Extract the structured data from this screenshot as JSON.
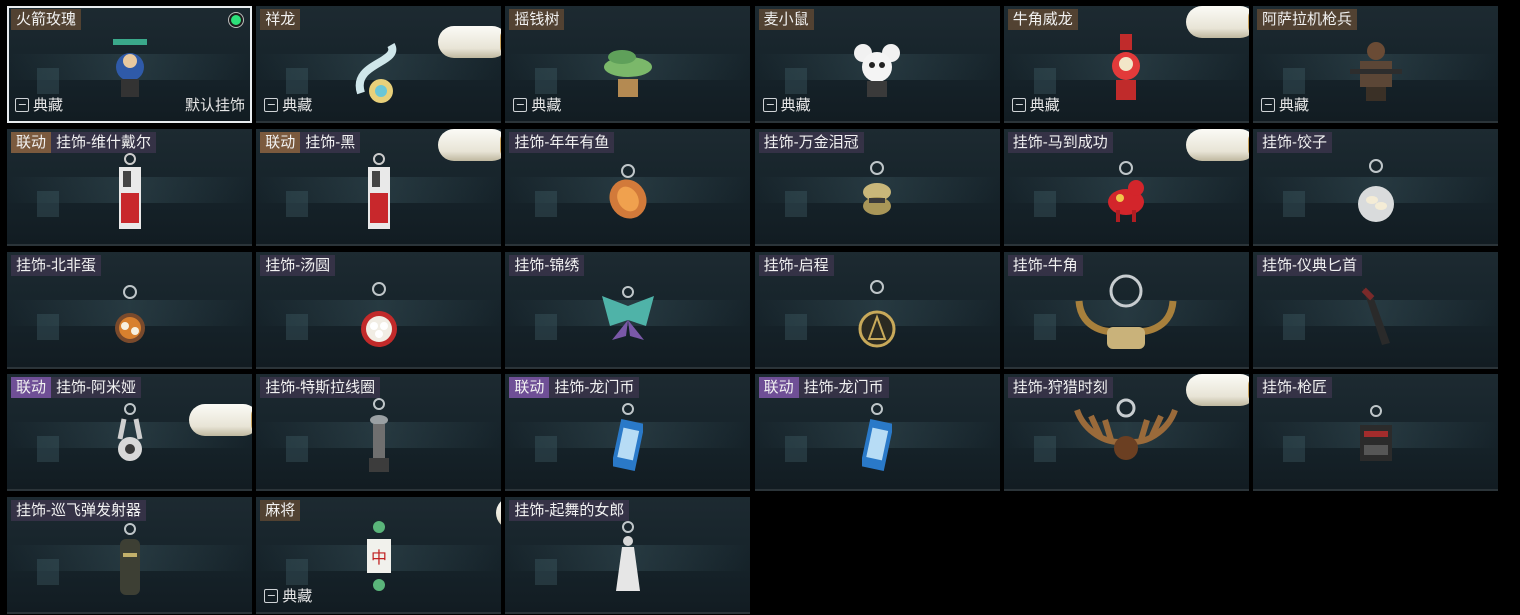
{
  "labels": {
    "collect": "典藏",
    "default_charm": "默认挂饰",
    "collab_tag": "联动"
  },
  "colors": {
    "selected_outline": "#e8ecef",
    "equipped_dot": "#2de07a",
    "brown_tag": "#7b5a3e",
    "purple_tag": "#6f4f96"
  },
  "items": [
    {
      "name": "火箭玫瑰",
      "icon": "rocket-rose-figure-icon",
      "collect": true,
      "selected": true,
      "equipped": true
    },
    {
      "name": "祥龙",
      "icon": "dragon-figure-icon",
      "collect": true
    },
    {
      "name": "摇钱树",
      "icon": "money-tree-icon",
      "collect": true
    },
    {
      "name": "麦小鼠",
      "icon": "mouse-figure-icon",
      "collect": true
    },
    {
      "name": "牛角威龙",
      "icon": "horned-dragon-figure-icon",
      "collect": true
    },
    {
      "name": "阿萨拉机枪兵",
      "icon": "gunner-figure-icon",
      "collect": true
    },
    {
      "name": "挂饰-维什戴尔",
      "collab": true,
      "collab_color": "brown",
      "icon": "card-charm-icon"
    },
    {
      "name": "挂饰-黑",
      "collab": true,
      "collab_color": "brown",
      "icon": "card-charm-icon"
    },
    {
      "name": "挂饰-年年有鱼",
      "icon": "fish-charm-icon"
    },
    {
      "name": "挂饰-万金泪冠",
      "icon": "coin-stack-charm-icon"
    },
    {
      "name": "挂饰-马到成功",
      "icon": "horse-charm-icon"
    },
    {
      "name": "挂饰-饺子",
      "icon": "dumpling-plate-charm-icon"
    },
    {
      "name": "挂饰-北非蛋",
      "icon": "shakshuka-charm-icon"
    },
    {
      "name": "挂饰-汤圆",
      "icon": "tangyuan-bowl-charm-icon"
    },
    {
      "name": "挂饰-锦绣",
      "icon": "butterfly-charm-icon"
    },
    {
      "name": "挂饰-启程",
      "icon": "compass-charm-icon"
    },
    {
      "name": "挂饰-牛角",
      "icon": "bull-horn-charm-icon"
    },
    {
      "name": "挂饰-仪典匕首",
      "icon": "dagger-charm-icon"
    },
    {
      "name": "挂饰-阿米娅",
      "collab": true,
      "collab_color": "purple",
      "icon": "bunny-charm-icon"
    },
    {
      "name": "挂饰-特斯拉线圈",
      "icon": "tesla-coil-charm-icon"
    },
    {
      "name": "挂饰-龙门币",
      "collab": true,
      "collab_color": "purple",
      "icon": "lungmen-coin-charm-icon"
    },
    {
      "name": "挂饰-龙门币",
      "collab": true,
      "collab_color": "purple",
      "icon": "lungmen-coin-charm-icon"
    },
    {
      "name": "挂饰-狩猎时刻",
      "icon": "moose-antler-charm-icon"
    },
    {
      "name": "挂饰-枪匠",
      "icon": "toolbox-charm-icon"
    },
    {
      "name": "挂饰-巡飞弹发射器",
      "icon": "launcher-charm-icon"
    },
    {
      "name": "麻将",
      "icon": "mahjong-tile-charm-icon",
      "collect": true,
      "collect_tile": "中"
    },
    {
      "name": "挂饰-起舞的女郎",
      "icon": "dancer-figurine-charm-icon"
    }
  ]
}
